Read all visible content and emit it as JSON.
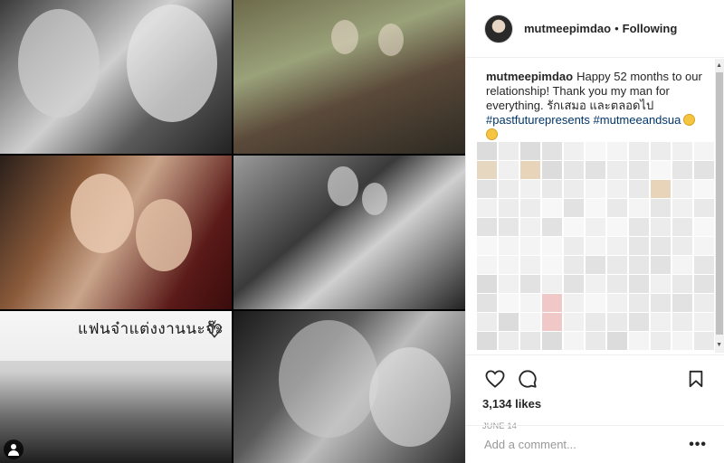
{
  "collage": {
    "overlay_text": "แฟนจ๋าแต่งงานนะจ๊ะ",
    "heart_icon": "heart-outline-icon",
    "user_tag_icon": "person-icon"
  },
  "header": {
    "username": "mutmeepimdao",
    "separator": "•",
    "follow_status": "Following"
  },
  "caption": {
    "username": "mutmeepimdao",
    "text": "Happy 52 months to our relationship! Thank you my man for everything. รักเสมอ และตลอดไป",
    "hashtags": [
      "#pastfuturepresents",
      "#mutmeeandsua"
    ],
    "emoji": "smiling-face-icon"
  },
  "actions": {
    "like_icon": "heart-outline-icon",
    "comment_icon": "comment-bubble-icon",
    "save_icon": "bookmark-icon",
    "likes": "3,134 likes",
    "date": "JUNE 14"
  },
  "comment_box": {
    "placeholder": "Add a comment...",
    "more_label": "•••"
  },
  "colors": {
    "hashtag": "#003569",
    "text": "#262626",
    "muted": "#999999",
    "border": "#efefef"
  }
}
